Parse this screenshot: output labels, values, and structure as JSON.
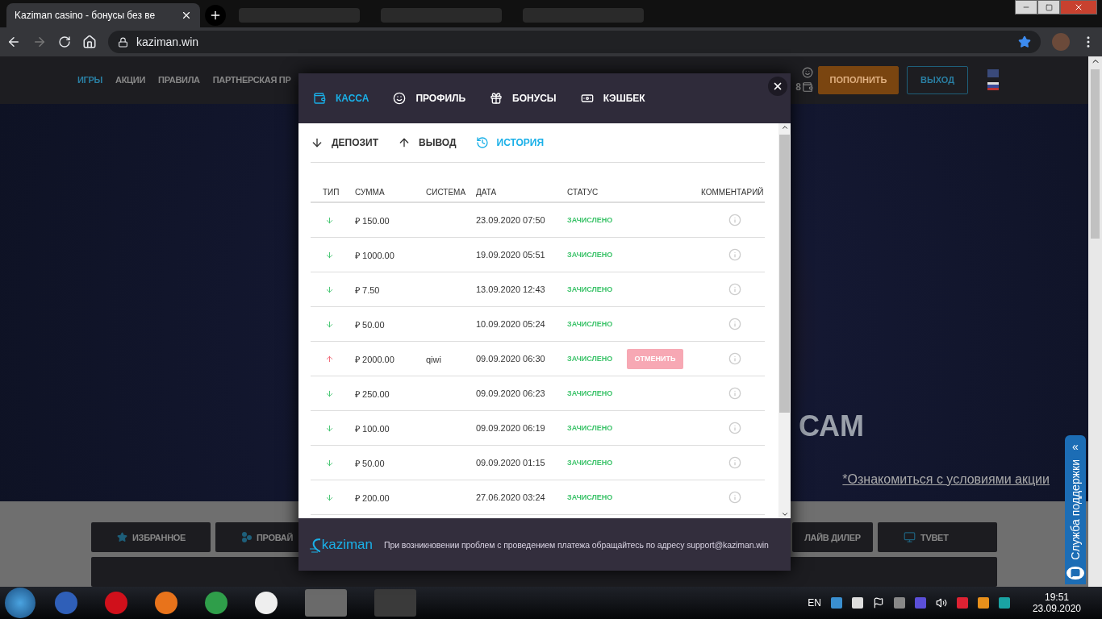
{
  "browser": {
    "tab_title": "Kaziman casino - бонусы без ве",
    "url": "kaziman.win"
  },
  "site_nav": [
    {
      "label": "ИГРЫ",
      "selected": true
    },
    {
      "label": "АКЦИИ",
      "selected": false
    },
    {
      "label": "ПРАВИЛА",
      "selected": false
    },
    {
      "label": "ПАРТНЕРСКАЯ ПР",
      "selected": false
    }
  ],
  "account": {
    "balance": "8"
  },
  "header_buttons": [
    {
      "label": "ПОПОЛНИТЬ",
      "kind": "primary"
    },
    {
      "label": "ВЫХОД",
      "kind": "outline"
    }
  ],
  "hero": {
    "headline": "САМ",
    "terms_link": "*Ознакомиться с условиями акции"
  },
  "categories": [
    {
      "label": "ИЗБРАННОЕ",
      "kind": "star"
    },
    {
      "label": "ПРОВАЙ",
      "kind": "dots"
    },
    {
      "label": "ЛАЙВ ДИЛЕР",
      "kind": "none"
    },
    {
      "label": "TVBET",
      "kind": "monitor"
    }
  ],
  "support": {
    "label": "Служба поддержки",
    "arrow": "«"
  },
  "modal": {
    "tabs": [
      {
        "label": "КАССА",
        "kind": "wallet",
        "selected": true
      },
      {
        "label": "ПРОФИЛЬ",
        "kind": "face",
        "selected": false
      },
      {
        "label": "БОНУСЫ",
        "kind": "gift",
        "selected": false
      },
      {
        "label": "КЭШБЕК",
        "kind": "cash",
        "selected": false
      }
    ],
    "subtabs": [
      {
        "label": "ДЕПОЗИТ",
        "kind": "down",
        "selected": false
      },
      {
        "label": "ВЫВОД",
        "kind": "up",
        "selected": false
      },
      {
        "label": "ИСТОРИЯ",
        "kind": "history",
        "selected": true
      }
    ],
    "columns": [
      "ТИП",
      "СУММА",
      "СИСТЕМА",
      "ДАТА",
      "СТАТУС",
      "КОММЕНТАРИЙ"
    ],
    "rows": [
      {
        "kind": "in",
        "amount": "₽ 150.00",
        "date": "23.09.2020 07:50",
        "status": "ЗАЧИСЛЕНО"
      },
      {
        "kind": "in",
        "amount": "₽ 1000.00",
        "date": "19.09.2020 05:51",
        "status": "ЗАЧИСЛЕНО"
      },
      {
        "kind": "in",
        "amount": "₽ 7.50",
        "date": "13.09.2020 12:43",
        "status": "ЗАЧИСЛЕНО"
      },
      {
        "kind": "in",
        "amount": "₽ 50.00",
        "date": "10.09.2020 05:24",
        "status": "ЗАЧИСЛЕНО"
      },
      {
        "kind": "out",
        "amount": "₽ 2000.00",
        "system": "qiwi",
        "date": "09.09.2020 06:30",
        "status": "ЗАЧИСЛЕНО",
        "action": "ОТМЕНИТЬ"
      },
      {
        "kind": "in",
        "amount": "₽ 250.00",
        "date": "09.09.2020 06:23",
        "status": "ЗАЧИСЛЕНО"
      },
      {
        "kind": "in",
        "amount": "₽ 100.00",
        "date": "09.09.2020 06:19",
        "status": "ЗАЧИСЛЕНО"
      },
      {
        "kind": "in",
        "amount": "₽ 50.00",
        "date": "09.09.2020 01:15",
        "status": "ЗАЧИСЛЕНО"
      },
      {
        "kind": "in",
        "amount": "₽ 200.00",
        "date": "27.06.2020 03:24",
        "status": "ЗАЧИСЛЕНО"
      }
    ],
    "footer_logo": "kaziman",
    "footer_text": "При возникновении проблем с проведением платежа обращайтесь по адресу support@kaziman.win"
  },
  "taskbar": {
    "language": "EN",
    "time": "19:51",
    "date": "23.09.2020"
  }
}
